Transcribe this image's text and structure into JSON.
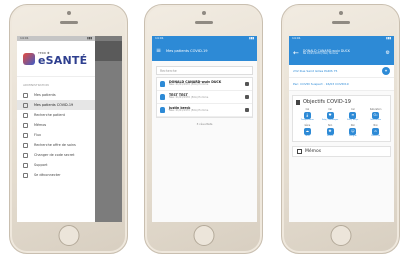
{
  "phone1": {
    "status_time": "14:01",
    "brand_small": "TERR ✚",
    "brand_big": "eSANTÉ",
    "section_label": "ADMINISTRATION",
    "menu": [
      {
        "label": "Mes patients",
        "icon": "user-icon",
        "active": false
      },
      {
        "label": "Mes patients COVID-19",
        "icon": "user-virus-icon",
        "active": true
      },
      {
        "label": "Recherche patient",
        "icon": "search-icon",
        "active": false
      },
      {
        "label": "Mémos",
        "icon": "memo-icon",
        "active": false
      },
      {
        "label": "Flux",
        "icon": "flux-icon",
        "active": false
      },
      {
        "label": "Recherche offre de soins",
        "icon": "location-icon",
        "active": false
      },
      {
        "label": "Changer de code secret",
        "icon": "key-icon",
        "active": false
      },
      {
        "label": "Support",
        "icon": "support-icon",
        "active": false
      },
      {
        "label": "Se déconnecter",
        "icon": "logout-icon",
        "active": false
      }
    ]
  },
  "phone2": {
    "status_time": "14:01",
    "title": "Mes patients COVID-19",
    "search_placeholder": "Recherche",
    "patients": [
      {
        "name": "DONALD CANARD-wuiv DUCK",
        "sub": "Née: 01/01/1970 (50A) Homme"
      },
      {
        "name": "TEST TEST",
        "sub": "Née: 01/01/1970 (50A) Homme"
      },
      {
        "name": "Justin berck",
        "sub": "Née: 01/01/1970 (50A) Homme"
      }
    ],
    "count_text": "3 résultats"
  },
  "phone3": {
    "status_time": "14:01",
    "title": "DONALD CANARD-wuiv DUCK",
    "subtitle": "Né 01/01/1970 (50A) Homme",
    "address": "232 Rue Saint Gilles PARIS 75",
    "status_line": "Pec: COVID Suspect · 16/03 COVID19",
    "objectif_title": "Objectifs COVID-19",
    "tiles": [
      {
        "top": "Cal",
        "label": "Température",
        "icon": "thermometer-icon",
        "glyph": "🌡"
      },
      {
        "top": "Cal",
        "label": "Fréq. Cardiaque",
        "icon": "heart-icon",
        "glyph": "♥"
      },
      {
        "top": "Cal",
        "label": "Fréq. Resp.",
        "icon": "lungs-icon",
        "glyph": "≋"
      },
      {
        "top": "Saturation",
        "label": "Saturation",
        "icon": "oxygen-icon",
        "glyph": "O₂"
      },
      {
        "top": "Gêne",
        "label": "Toux",
        "icon": "cough-icon",
        "glyph": "☁"
      },
      {
        "top": "Non",
        "label": "Fièvre",
        "icon": "fever-icon",
        "glyph": "✺"
      },
      {
        "top": "Non",
        "label": "Fatigue",
        "icon": "fatigue-icon",
        "glyph": "☹"
      },
      {
        "top": "Non",
        "label": "Domicile",
        "icon": "home-icon",
        "glyph": "⌂"
      }
    ],
    "memos_label": "Mémos"
  }
}
